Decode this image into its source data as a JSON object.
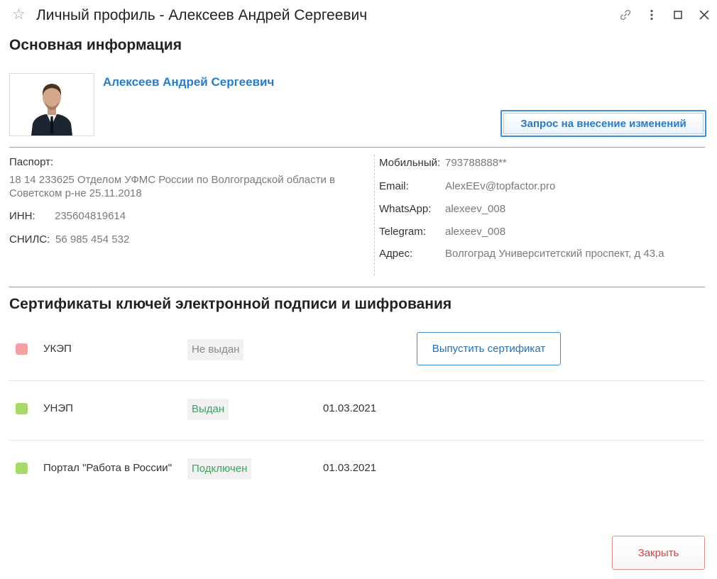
{
  "window": {
    "title": "Личный профиль - Алексеев Андрей Сергеевич",
    "star_icon": "star-icon",
    "controls": [
      "link-icon",
      "more-vertical-icon",
      "maximize-icon",
      "close-icon"
    ]
  },
  "main_info": {
    "heading": "Основная информация",
    "full_name": "Алексеев Андрей Сергеевич",
    "request_button": "Запрос на внесение изменений"
  },
  "documents": {
    "passport_label": "Паспорт:",
    "passport_value": "18 14 233625 Отделом УФМС России по Волгоградской области в Советском р-не 25.11.2018",
    "inn_label": "ИНН:",
    "inn_value": "235604819614",
    "snils_label": "СНИЛС:",
    "snils_value": "56 985 454 532"
  },
  "contacts": [
    {
      "label": "Мобильный:",
      "value": "793788888**"
    },
    {
      "label": "Email:",
      "value": "AlexEEv@topfactor.pro"
    },
    {
      "label": "WhatsApp:",
      "value": "alexeev_008"
    },
    {
      "label": "Telegram:",
      "value": "alexeev_008"
    },
    {
      "label": "Адрес:",
      "value": "Волгоград Университетский проспект, д 43.а"
    }
  ],
  "certificates": {
    "heading": "Сертификаты ключей электронной подписи и шифрования",
    "items": [
      {
        "name": "УКЭП",
        "status": "Не выдан",
        "date": "",
        "indicator_color": "#f4a0a4",
        "status_color": "#8a8a8a"
      },
      {
        "name": "УНЭП",
        "status": "Выдан",
        "date": "01.03.2021",
        "indicator_color": "#a6d96a",
        "status_color": "#3aa55d"
      },
      {
        "name": "Портал \"Работа в России\"",
        "status": "Подключен",
        "date": "01.03.2021",
        "indicator_color": "#a6d96a",
        "status_color": "#3aa55d"
      }
    ],
    "issue_button": "Выпустить сертификат"
  },
  "footer": {
    "close_button": "Закрыть"
  }
}
